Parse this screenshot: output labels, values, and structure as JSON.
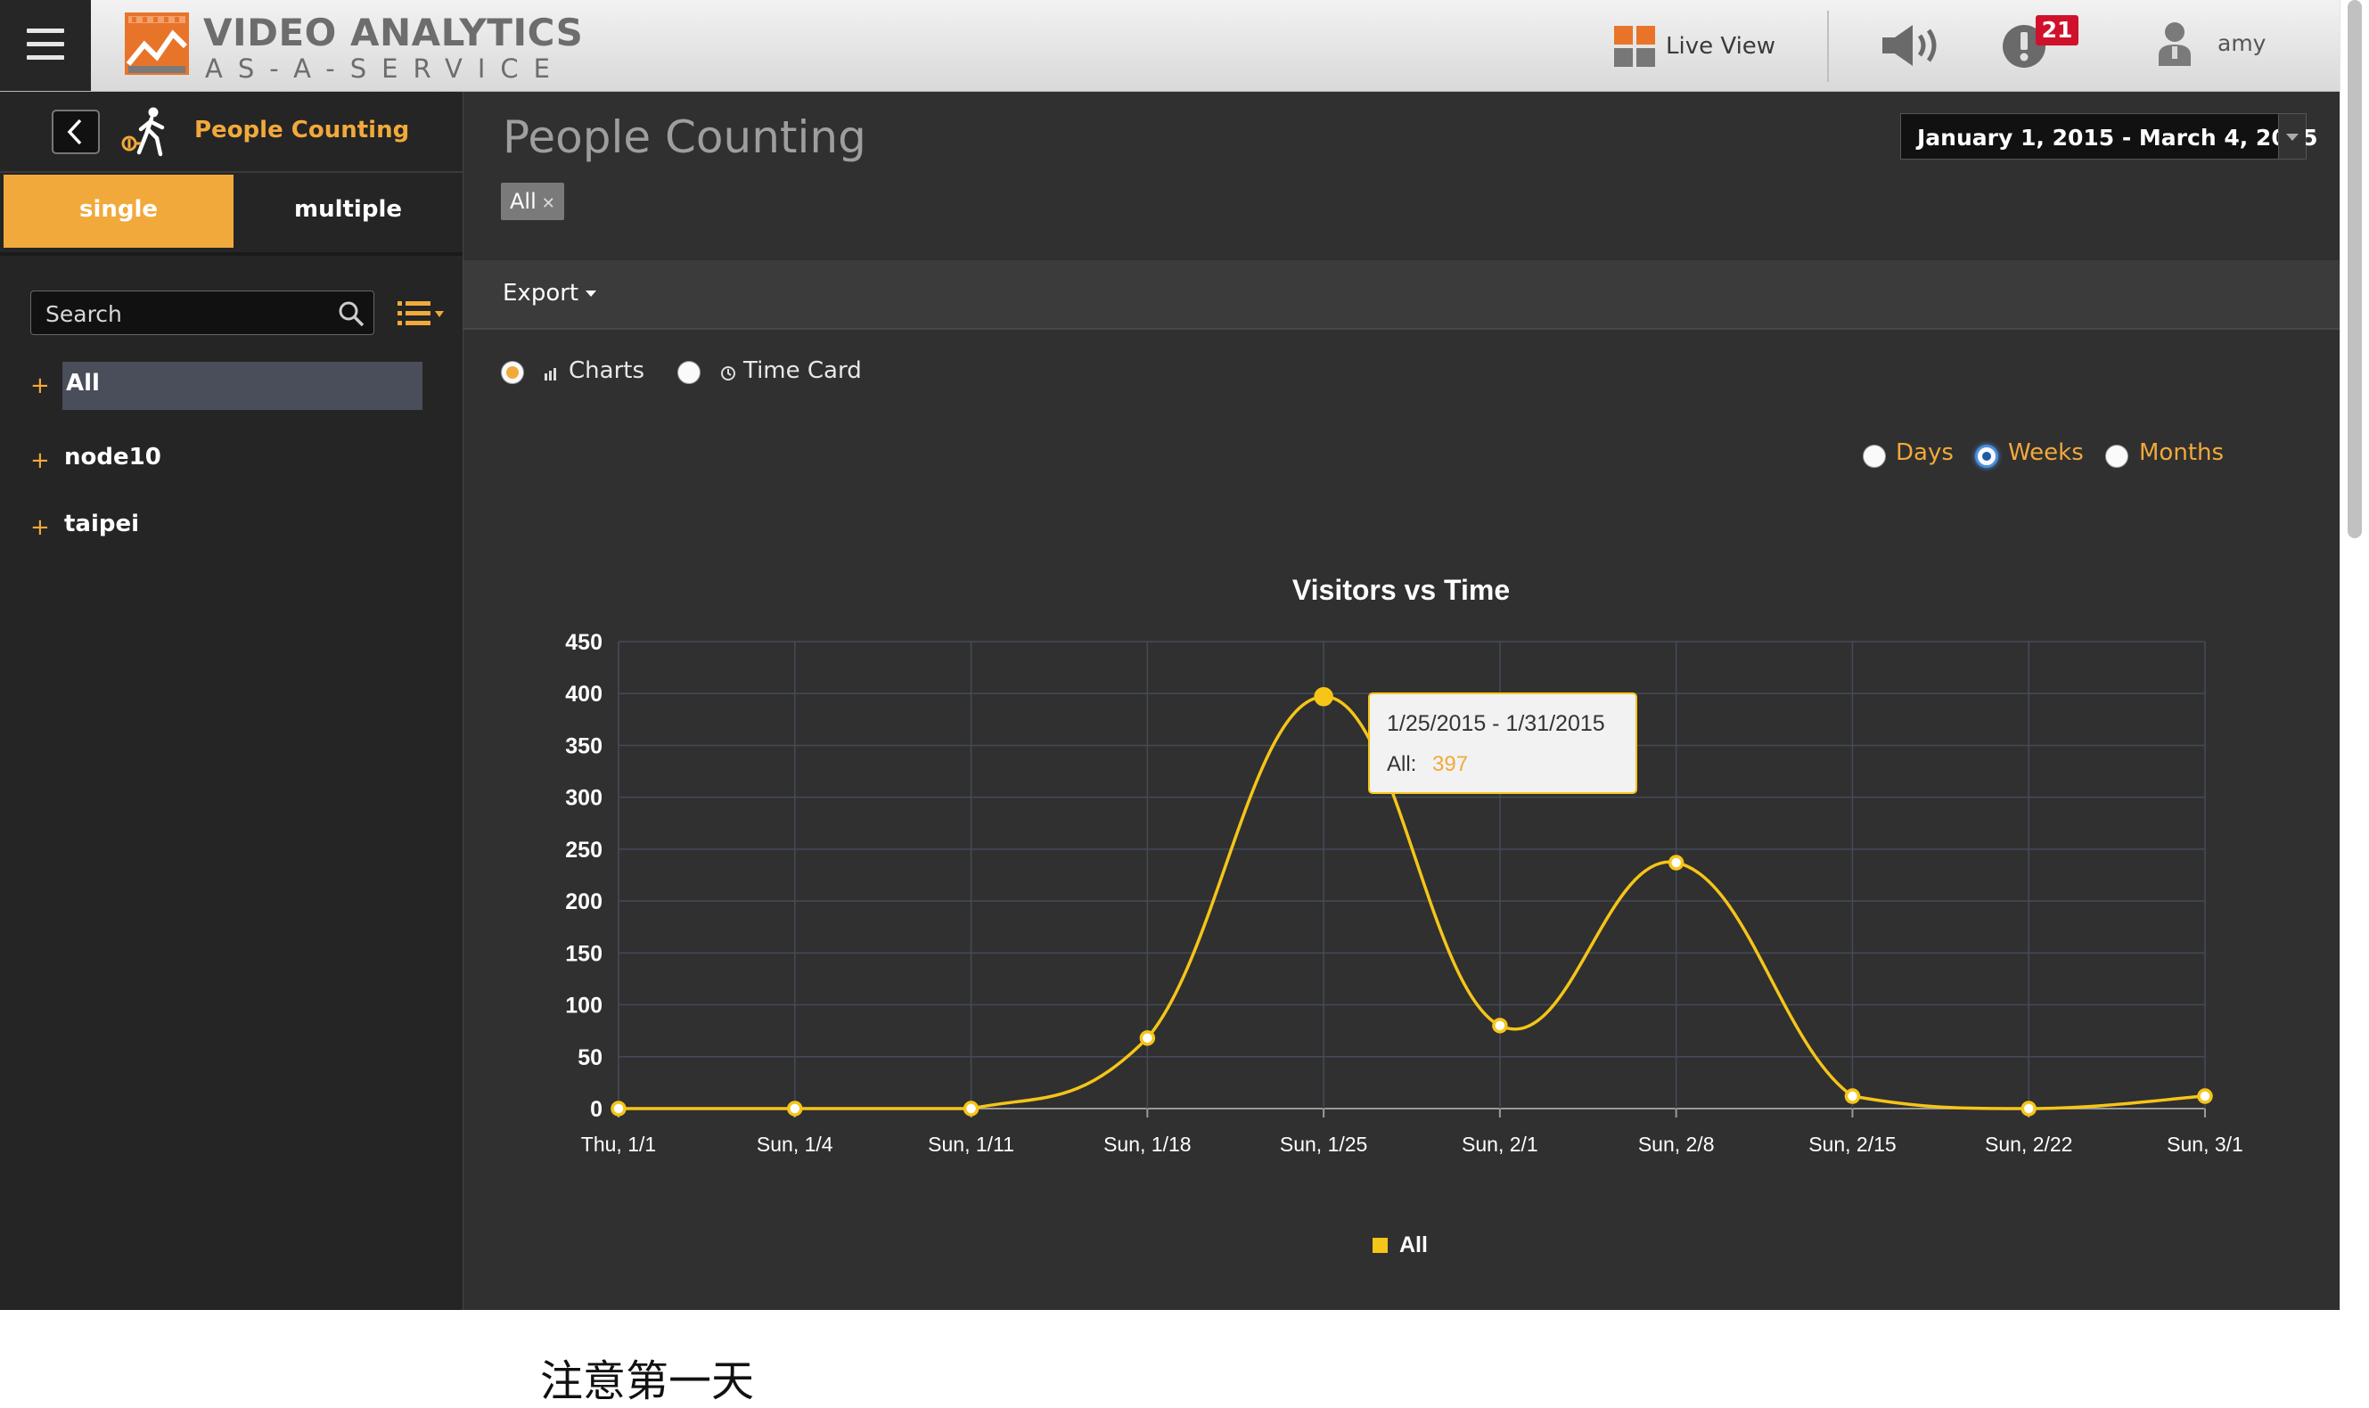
{
  "header": {
    "brand_title": "VIDEO ANALYTICS",
    "brand_subtitle": "AS-A-SERVICE",
    "live_view_label": "Live View",
    "alert_count": "21",
    "user_name": "amy",
    "colors": {
      "brand_orange": "#f2a93b",
      "alert_red": "#d0112b"
    }
  },
  "sidebar": {
    "title": "People Counting",
    "tabs": [
      {
        "label": "single",
        "active": true
      },
      {
        "label": "multiple",
        "active": false
      }
    ],
    "search_placeholder": "Search",
    "tree": [
      {
        "label": "All",
        "selected": true
      },
      {
        "label": "node10",
        "selected": false
      },
      {
        "label": "taipei",
        "selected": false
      }
    ]
  },
  "main": {
    "page_title": "People Counting",
    "filter_chip": "All",
    "date_range": "January 1, 2015 - March 4, 2015",
    "export_label": "Export",
    "view_options": [
      {
        "label": "Charts",
        "selected": true
      },
      {
        "label": "Time Card",
        "selected": false
      }
    ],
    "granularity": [
      {
        "label": "Days",
        "selected": false
      },
      {
        "label": "Weeks",
        "selected": true
      },
      {
        "label": "Months",
        "selected": false
      }
    ],
    "tooltip": {
      "range": "1/25/2015 - 1/31/2015",
      "series": "All:",
      "value": "397"
    }
  },
  "chart_data": {
    "type": "line",
    "title": "Visitors vs Time",
    "xlabel": "",
    "ylabel": "",
    "ylim": [
      0,
      450
    ],
    "yticks": [
      0,
      50,
      100,
      150,
      200,
      250,
      300,
      350,
      400,
      450
    ],
    "categories": [
      "Thu, 1/1",
      "Sun, 1/4",
      "Sun, 1/11",
      "Sun, 1/18",
      "Sun, 1/25",
      "Sun, 2/1",
      "Sun, 2/8",
      "Sun, 2/15",
      "Sun, 2/22",
      "Sun, 3/1"
    ],
    "series": [
      {
        "name": "All",
        "color": "#f5c518",
        "values": [
          0,
          0,
          0,
          68,
          397,
          80,
          237,
          12,
          0,
          12
        ]
      }
    ],
    "grid": true,
    "legend_position": "bottom-center",
    "highlighted_index": 4
  },
  "caption": "注意第一天"
}
